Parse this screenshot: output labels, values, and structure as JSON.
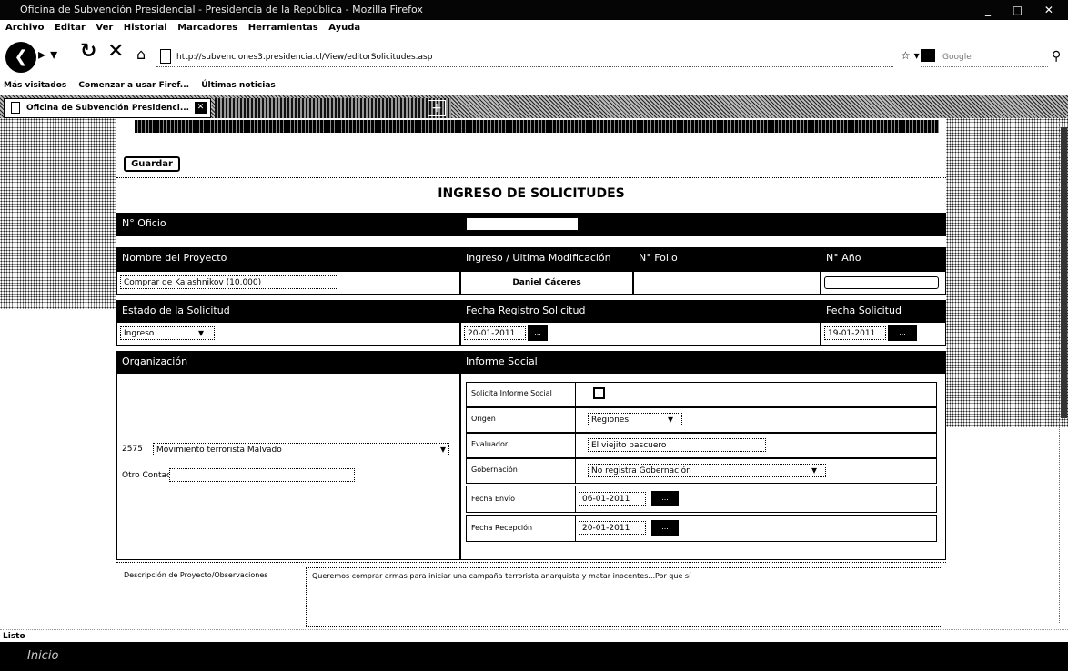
{
  "window": {
    "title": "Oficina de Subvención Presidencial - Presidencia de la República - Mozilla Firefox",
    "controls": "_ □ ✕"
  },
  "menu": [
    "Archivo",
    "Editar",
    "Ver",
    "Historial",
    "Marcadores",
    "Herramientas",
    "Ayuda"
  ],
  "browser": {
    "url": "http://subvenciones3.presidencia.cl/View/editorSolicitudes.asp",
    "search_placeholder": "Google",
    "bookmarks": [
      "Más visitados",
      "Comenzar a usar Firef...",
      "Últimas noticias"
    ],
    "tab_active": "Oficina de Subvención Presidenci...",
    "tab_close": "✕",
    "tab_new": "+"
  },
  "form": {
    "guardar_label": "Guardar",
    "title": "INGRESO DE SOLICITUDES",
    "n_oficio_label": "N° Oficio",
    "n_oficio_value": "",
    "nombre_proyecto_label": "Nombre del Proyecto",
    "nombre_proyecto_value": "Comprar de Kalashnikov (10.000)",
    "ingreso_label": "Ingreso / Ultima Modificación",
    "ingreso_value": "Daniel Cáceres",
    "n_folio_label": "N° Folio",
    "n_folio_value": "",
    "n_ano_label": "N° Año",
    "n_ano_value": "",
    "estado_label": "Estado de la Solicitud",
    "estado_value": "Ingreso",
    "fecha_registro_label": "Fecha Registro Solicitud",
    "fecha_registro_value": "20-01-2011",
    "fecha_solicitud_label": "Fecha Solicitud",
    "fecha_solicitud_value": "19-01-2011",
    "cal_label": "...",
    "organizacion_label": "Organización",
    "org_code": "2575",
    "org_value": "Movimiento terrorista Malvado",
    "otro_contacto_label": "Otro Contacto:",
    "otro_contacto_value": "",
    "informe_social_label": "Informe Social",
    "solicita_informe_label": "Solicita Informe Social",
    "origen_label": "Origen",
    "origen_value": "Regiones",
    "evaluador_label": "Evaluador",
    "evaluador_value": "El viejito pascuero",
    "gobernacion_label": "Gobernación",
    "gobernacion_value": "No registra Gobernación",
    "fecha_envio_label": "Fecha Envío",
    "fecha_envio_value": "06-01-2011",
    "fecha_recepcion_label": "Fecha Recepción",
    "fecha_recepcion_value": "20-01-2011",
    "descripcion_label": "Descripción de Proyecto/Observaciones",
    "descripcion_value": "Queremos comprar armas para iniciar una campaña terrorista anarquista y matar inocentes...Por que sí"
  },
  "status": "Listo",
  "taskbar": {
    "start": "Inicio"
  }
}
